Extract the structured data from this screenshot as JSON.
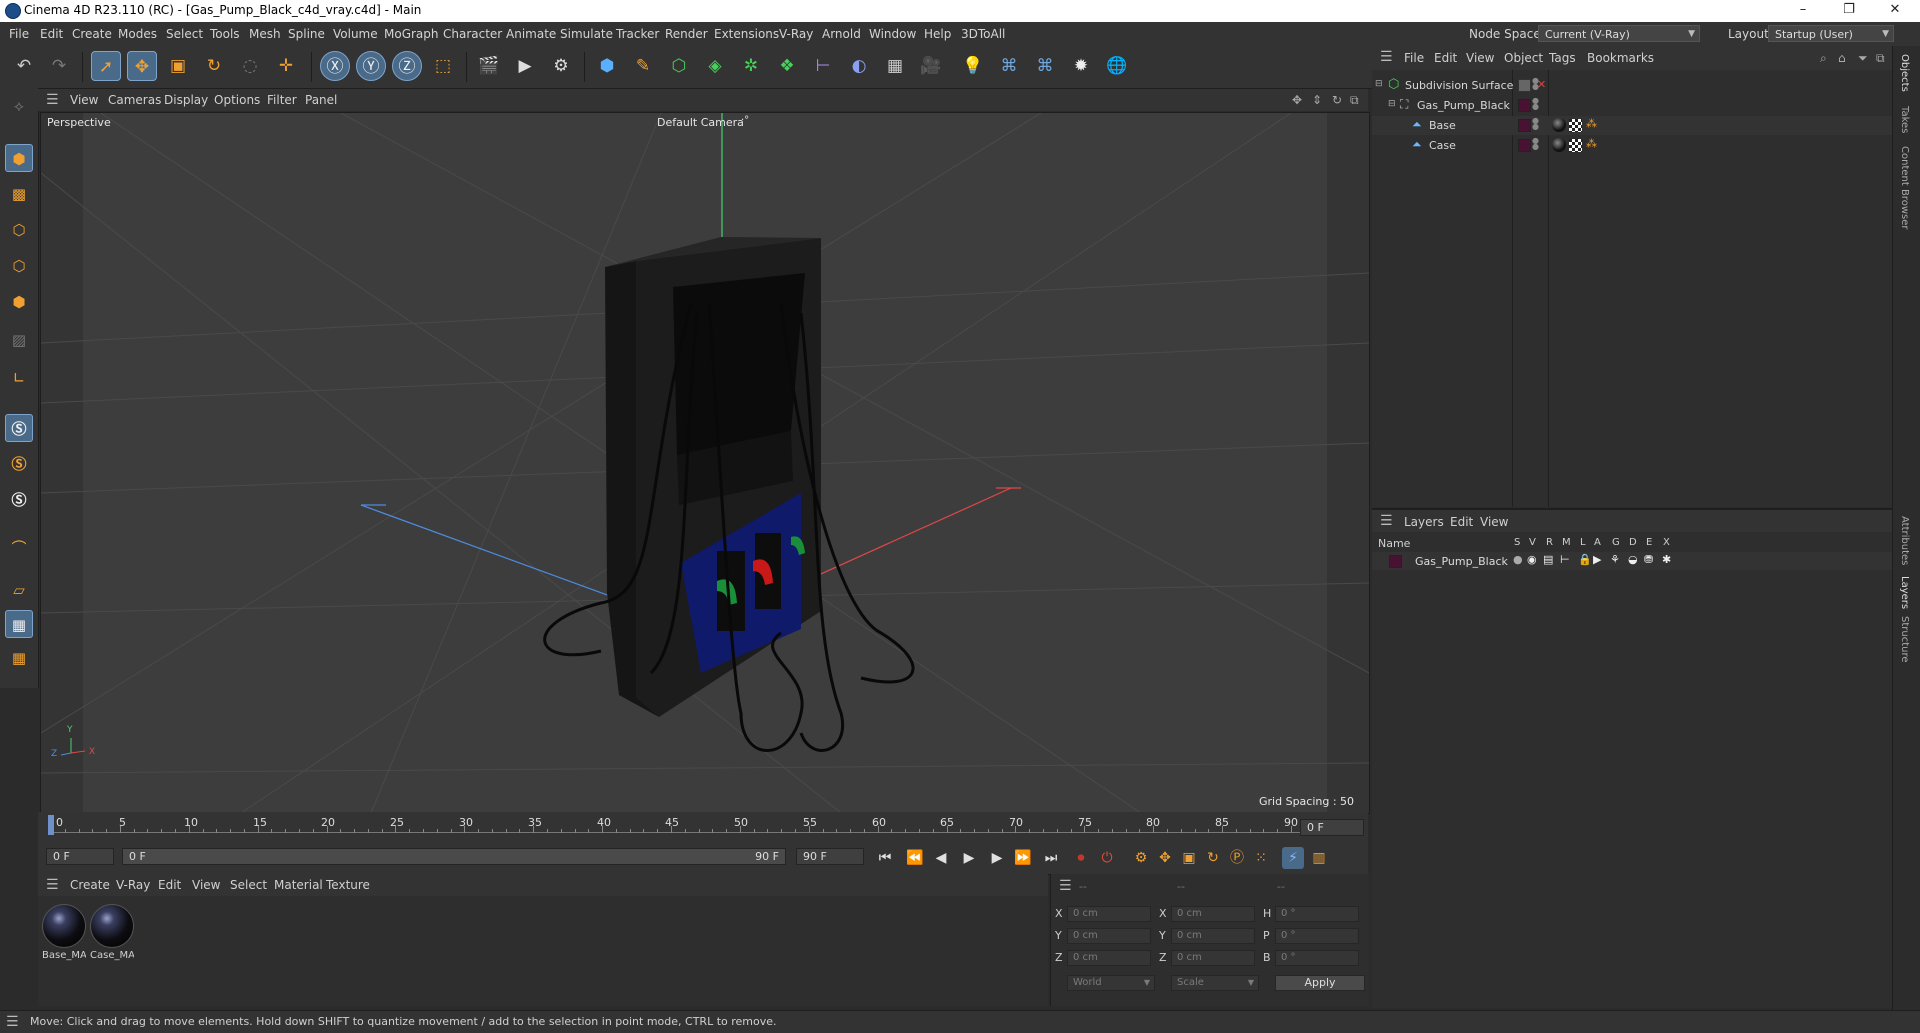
{
  "window": {
    "title": "Cinema 4D R23.110 (RC) - [Gas_Pump_Black_c4d_vray.c4d] - Main",
    "minimize": "–",
    "maximize": "❐",
    "close": "✕"
  },
  "menubar": {
    "items": [
      "File",
      "Edit",
      "Create",
      "Modes",
      "Select",
      "Tools",
      "Mesh",
      "Spline",
      "Volume",
      "MoGraph",
      "Character",
      "Animate",
      "Simulate",
      "Tracker",
      "Render",
      "Extensions",
      "V-Ray",
      "Arnold",
      "Window",
      "Help",
      "3DToAll"
    ],
    "node_space_label": "Node Space:",
    "node_space_value": "Current (V-Ray)",
    "layout_label": "Layout:",
    "layout_value": "Startup (User)"
  },
  "viewport": {
    "menu": [
      "View",
      "Cameras",
      "Display",
      "Options",
      "Filter",
      "Panel"
    ],
    "view_name": "Perspective",
    "camera_name": "Default Camera",
    "camera_suffix": "·°",
    "grid_spacing": "Grid Spacing : 50 cm",
    "axis_y": "Y",
    "axis_z": "Z",
    "axis_x": "X"
  },
  "timeline": {
    "ticks": [
      "0",
      "5",
      "10",
      "15",
      "20",
      "25",
      "30",
      "35",
      "40",
      "45",
      "50",
      "55",
      "60",
      "65",
      "70",
      "75",
      "80",
      "85",
      "90"
    ],
    "current_frame": "0 F",
    "start_field": "0 F",
    "range_start": "0 F",
    "range_end": "90 F",
    "end_field": "90 F"
  },
  "materials": {
    "menu": [
      "Create",
      "V-Ray",
      "Edit",
      "View",
      "Select",
      "Material",
      "Texture"
    ],
    "items": [
      {
        "label": "Base_MA"
      },
      {
        "label": "Case_MA"
      }
    ]
  },
  "coords": {
    "headers": [
      "--",
      "--",
      "--"
    ],
    "rows": [
      {
        "a": "X",
        "av": "0 cm",
        "b": "X",
        "bv": "0 cm",
        "c": "H",
        "cv": "0 °"
      },
      {
        "a": "Y",
        "av": "0 cm",
        "b": "Y",
        "bv": "0 cm",
        "c": "P",
        "cv": "0 °"
      },
      {
        "a": "Z",
        "av": "0 cm",
        "b": "Z",
        "bv": "0 cm",
        "c": "B",
        "cv": "0 °"
      }
    ],
    "space": "World",
    "mode": "Scale",
    "apply": "Apply"
  },
  "status": "Move: Click and drag to move elements. Hold down SHIFT to quantize movement / add to the selection in point mode, CTRL to remove.",
  "objects": {
    "menu": [
      "File",
      "Edit",
      "View",
      "Object",
      "Tags",
      "Bookmarks"
    ],
    "rows": [
      {
        "name": "Subdivision Surface"
      },
      {
        "name": "Gas_Pump_Black"
      },
      {
        "name": "Base"
      },
      {
        "name": "Case"
      }
    ]
  },
  "layers": {
    "menu": [
      "Layers",
      "Edit",
      "View"
    ],
    "col_name": "Name",
    "cols": [
      "S",
      "V",
      "R",
      "M",
      "L",
      "A",
      "G",
      "D",
      "E",
      "X"
    ],
    "rows": [
      {
        "name": "Gas_Pump_Black"
      }
    ]
  },
  "side_tabs": [
    "Objects",
    "Takes",
    "Content Browser",
    "Attributes",
    "Layers",
    "Structure"
  ],
  "colors": {
    "accent": "#4a6a8a",
    "layer": "#4a1232",
    "viewport_bg": "#3d3d3d"
  }
}
